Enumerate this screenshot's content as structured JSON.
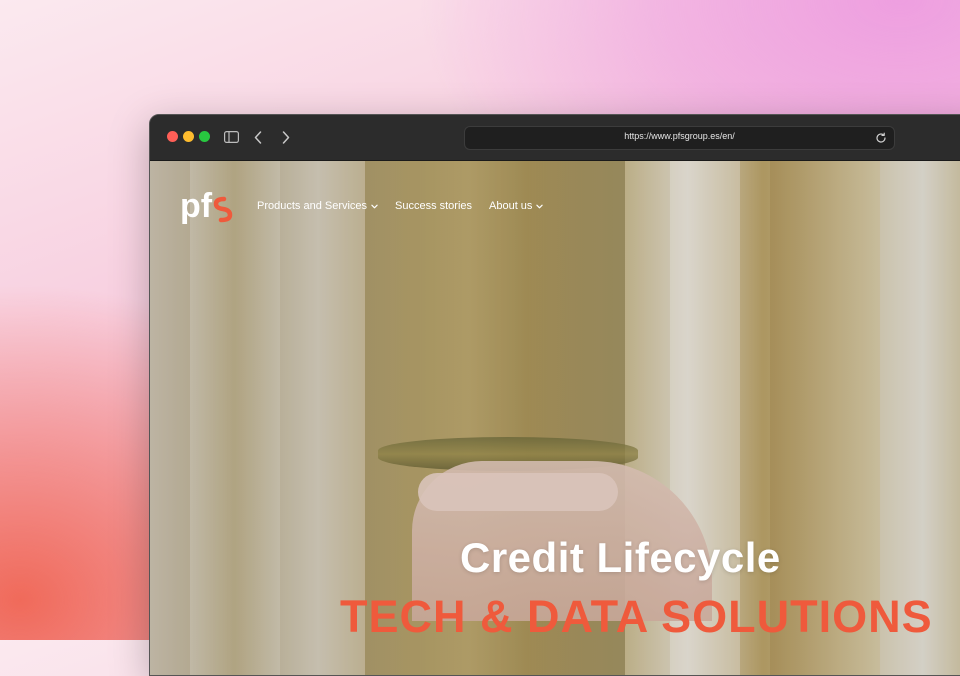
{
  "browser": {
    "url": "https://www.pfsgroup.es/en/"
  },
  "site": {
    "logo_text": "pfs",
    "nav": [
      {
        "label": "Products and Services",
        "has_dropdown": true
      },
      {
        "label": "Success stories",
        "has_dropdown": false
      },
      {
        "label": "About us",
        "has_dropdown": true
      }
    ]
  },
  "hero": {
    "title": "Credit Lifecycle",
    "subtitle": "TECH & DATA SOLUTIONS",
    "subtitle_color": "#ef5a3c"
  },
  "icons": [
    "sidebar-toggle-icon",
    "back-arrow-icon",
    "forward-arrow-icon",
    "reload-icon",
    "chevron-down-icon"
  ]
}
